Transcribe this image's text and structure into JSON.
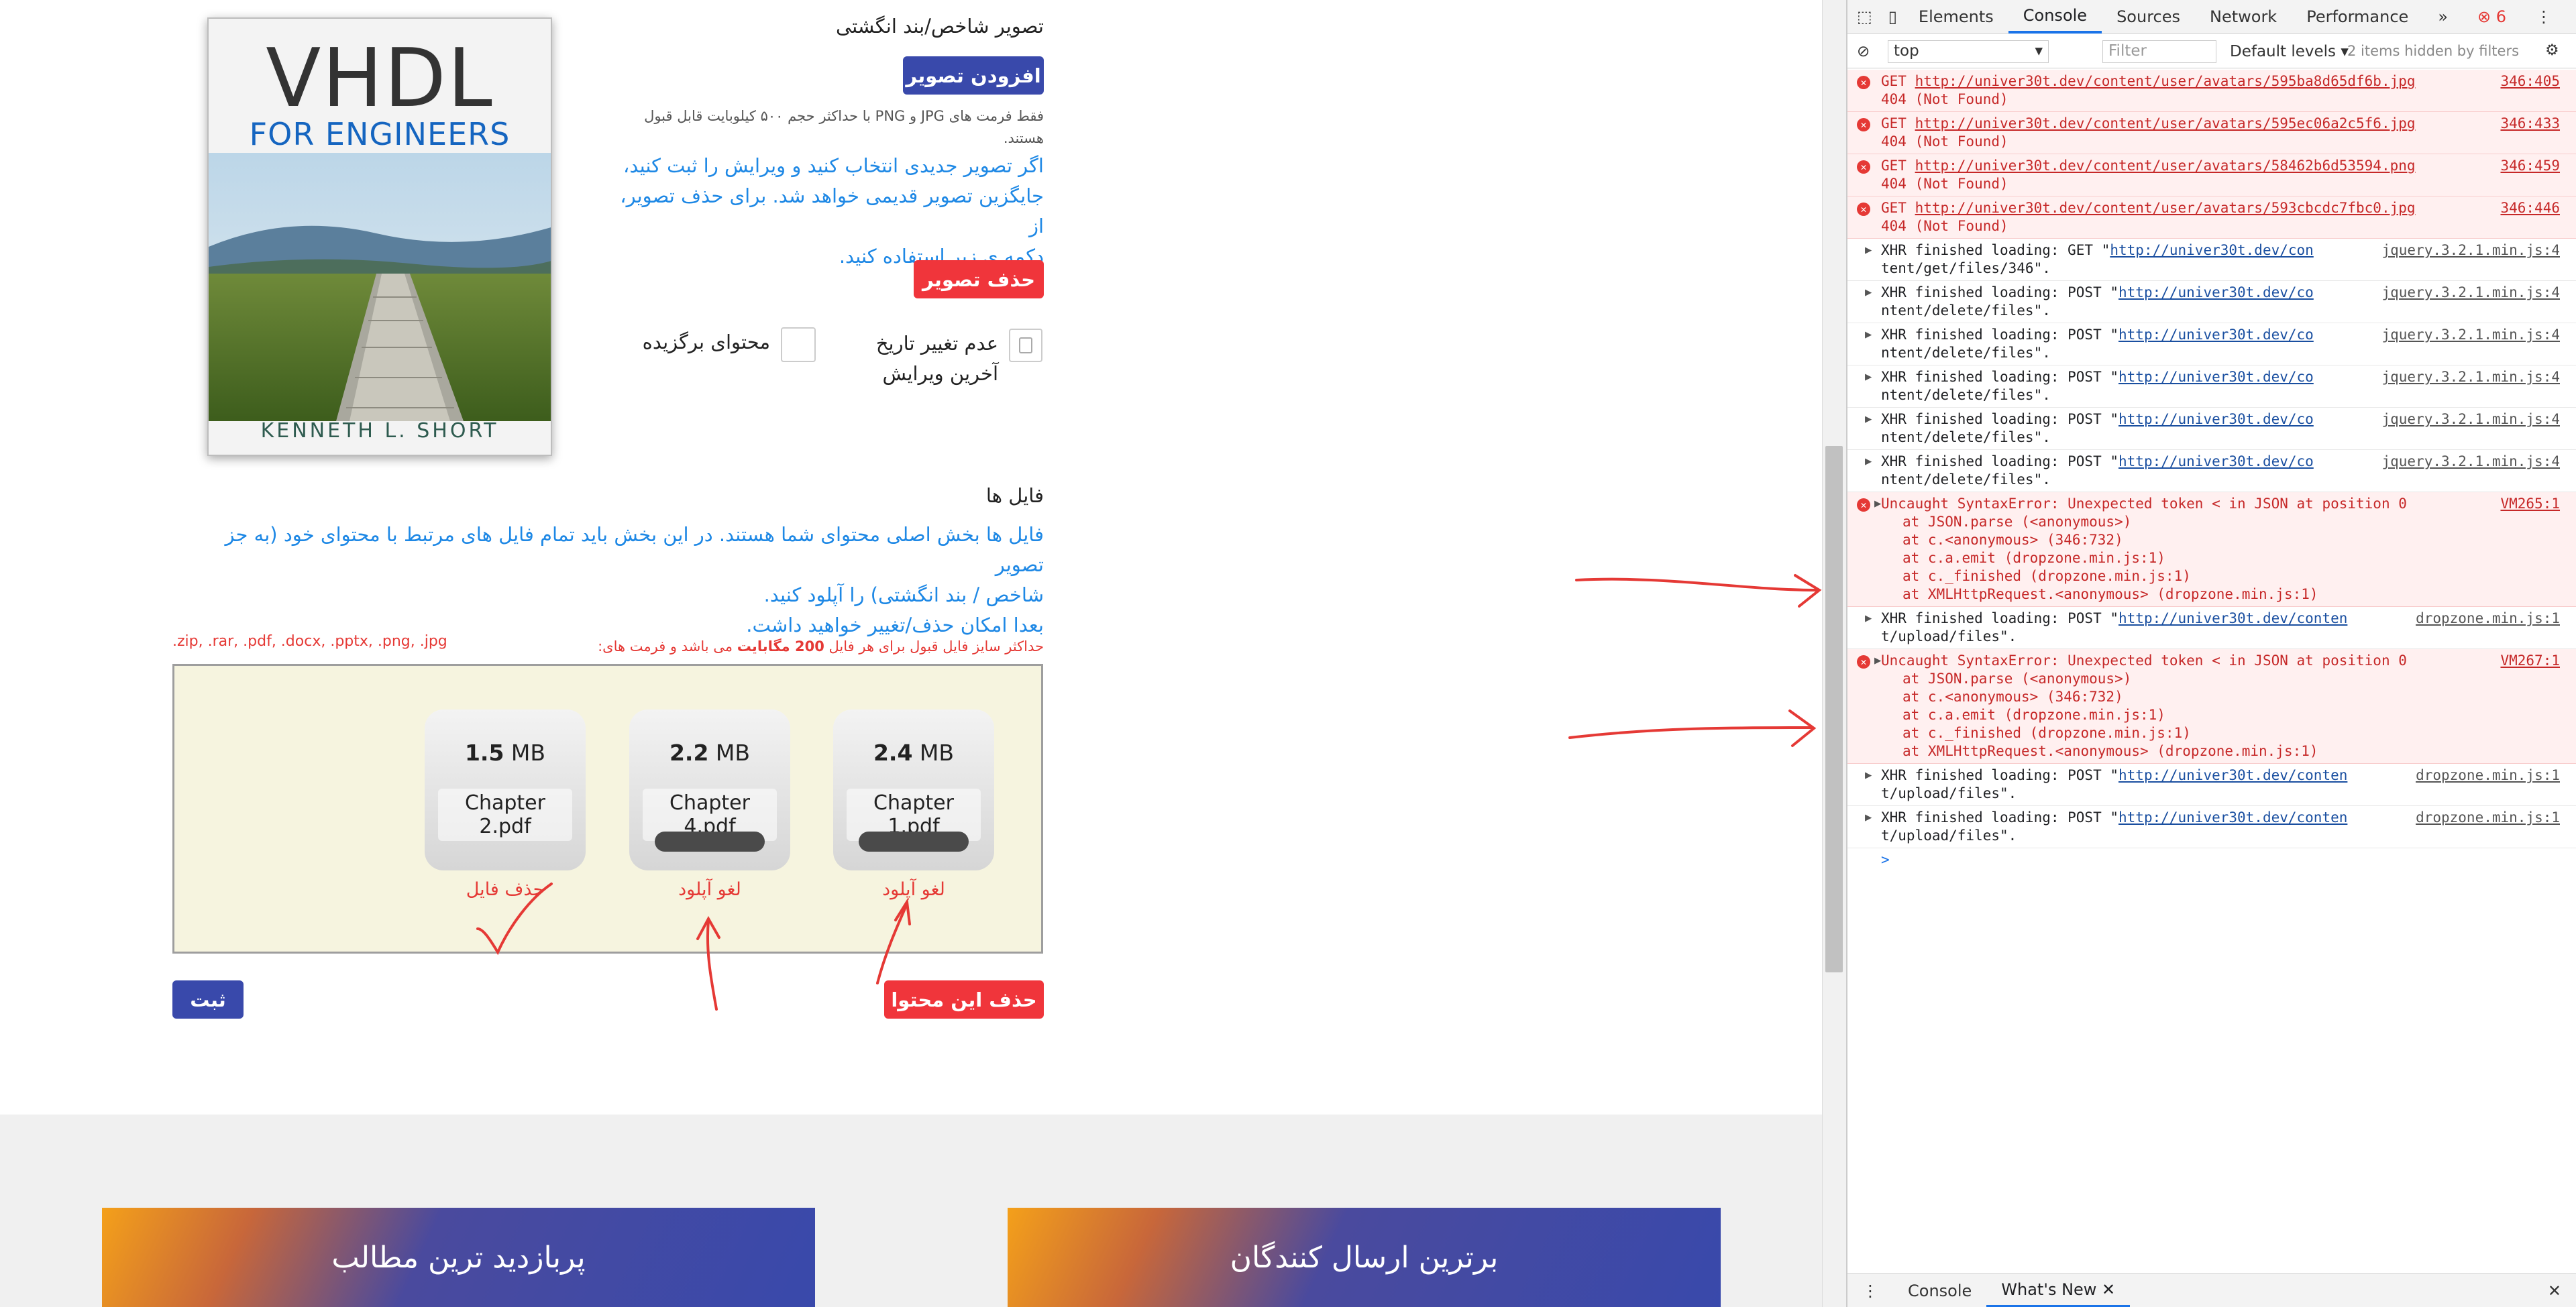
{
  "image_section": {
    "title": "تصویر شاخص/بند انگشتی",
    "add_button": "افزودن تصویر",
    "format_note": "فقط فرمت های JPG و PNG با حداکثر حجم ۵۰۰ کیلوبایت قابل قبول هستند.",
    "help_line1": "اگر تصویر جدیدی انتخاب کنید و ویرایش را ثبت کنید،",
    "help_line2": "جایگزین تصویر قدیمی خواهد شد. برای حذف تصویر، از",
    "help_line3": "دکمه ی زیر استفاده کنید.",
    "delete_button": "حذف تصویر",
    "checkbox1_label_1": "عدم تغییر تاریخ",
    "checkbox1_label_2": "آخرین ویرایش",
    "checkbox2_label": "محتوای برگزیده",
    "book": {
      "title": "VHDL",
      "subtitle": "FOR ENGINEERS",
      "author": "KENNETH L. SHORT"
    }
  },
  "files_section": {
    "title": "فایل ها",
    "desc_line1": "فایل ها بخش اصلی محتوای شما هستند. در این بخش باید تمام فایل های مرتبط با محتوای خود (به جز تصویر",
    "desc_line2": "شاخص / بند انگشتی) را آپلود کنید.",
    "desc_line3": "بعدا امکان حذف/تغییر خواهید داشت.",
    "limit_prefix": "حداکثر سایز فایل قبول برای هر فایل",
    "limit_value": "200 مگابایت",
    "limit_suffix": "می باشد و فرمت های:",
    "formats": ".zip, .rar, .pdf, .docx, .pptx, .png, .jpg",
    "files": [
      {
        "size_num": "2.4",
        "size_unit": "MB",
        "name": "Chapter 1.pdf",
        "action": "لغو آپلود",
        "uploading": true
      },
      {
        "size_num": "2.2",
        "size_unit": "MB",
        "name": "Chapter 4.pdf",
        "action": "لغو آپلود",
        "uploading": true
      },
      {
        "size_num": "1.5",
        "size_unit": "MB",
        "name": "Chapter 2.pdf",
        "action": "حذف فایل",
        "uploading": false
      }
    ],
    "delete_content_button": "حذف این محتوا",
    "submit_button": "ثبت"
  },
  "footer": {
    "box_right": "برترین ارسال کنندگان",
    "box_left": "پربازدید ترین مطالب"
  },
  "devtools": {
    "tabs": [
      "Elements",
      "Console",
      "Sources",
      "Network",
      "Performance"
    ],
    "more": "»",
    "error_count": "6",
    "context": "top",
    "filter_placeholder": "Filter",
    "levels": "Default levels",
    "hidden": "2 items hidden by filters",
    "bottom_tabs": [
      "Console",
      "What's New"
    ],
    "prompt": ">",
    "logs": [
      {
        "type": "error",
        "text1": "GET ",
        "link": "http://univer30t.dev/content/user/avatars/595ba8d65df6b.jpg",
        "text2": "404 (Not Found)",
        "src": "346:405"
      },
      {
        "type": "error",
        "text1": "GET ",
        "link": "http://univer30t.dev/content/user/avatars/595ec06a2c5f6.jpg",
        "text2": "404 (Not Found)",
        "src": "346:433"
      },
      {
        "type": "error",
        "text1": "GET ",
        "link": "http://univer30t.dev/content/user/avatars/58462b6d53594.png",
        "text2": "404 (Not Found)",
        "src": "346:459"
      },
      {
        "type": "error",
        "text1": "GET ",
        "link": "http://univer30t.dev/content/user/avatars/593cbcdc7fbc0.jpg",
        "text2": "404 (Not Found)",
        "src": "346:446"
      },
      {
        "type": "info",
        "text1": "XHR finished loading: GET \"",
        "link": "http://univer30t.dev/con",
        "text2": "tent/get/files/346\".",
        "src": "jquery.3.2.1.min.js:4"
      },
      {
        "type": "info",
        "text1": "XHR finished loading: POST \"",
        "link": "http://univer30t.dev/co",
        "text2": "ntent/delete/files\".",
        "src": "jquery.3.2.1.min.js:4"
      },
      {
        "type": "info",
        "text1": "XHR finished loading: POST \"",
        "link": "http://univer30t.dev/co",
        "text2": "ntent/delete/files\".",
        "src": "jquery.3.2.1.min.js:4"
      },
      {
        "type": "info",
        "text1": "XHR finished loading: POST \"",
        "link": "http://univer30t.dev/co",
        "text2": "ntent/delete/files\".",
        "src": "jquery.3.2.1.min.js:4"
      },
      {
        "type": "info",
        "text1": "XHR finished loading: POST \"",
        "link": "http://univer30t.dev/co",
        "text2": "ntent/delete/files\".",
        "src": "jquery.3.2.1.min.js:4"
      },
      {
        "type": "info",
        "text1": "XHR finished loading: POST \"",
        "link": "http://univer30t.dev/co",
        "text2": "ntent/delete/files\".",
        "src": "jquery.3.2.1.min.js:4"
      },
      {
        "type": "stack",
        "text1": "Uncaught SyntaxError: Unexpected token < in JSON at position 0",
        "lines": [
          "at JSON.parse (<anonymous>)",
          "at c.<anonymous> (346:732)",
          "at c.a.emit (dropzone.min.js:1)",
          "at c._finished (dropzone.min.js:1)",
          "at XMLHttpRequest.<anonymous> (dropzone.min.js:1)"
        ],
        "src": "VM265:1"
      },
      {
        "type": "info",
        "text1": "XHR finished loading: POST \"",
        "link": "http://univer30t.dev/conten",
        "text2": "t/upload/files\".",
        "src": "dropzone.min.js:1"
      },
      {
        "type": "stack",
        "text1": "Uncaught SyntaxError: Unexpected token < in JSON at position 0",
        "lines": [
          "at JSON.parse (<anonymous>)",
          "at c.<anonymous> (346:732)",
          "at c.a.emit (dropzone.min.js:1)",
          "at c._finished (dropzone.min.js:1)",
          "at XMLHttpRequest.<anonymous> (dropzone.min.js:1)"
        ],
        "src": "VM267:1"
      },
      {
        "type": "info",
        "text1": "XHR finished loading: POST \"",
        "link": "http://univer30t.dev/conten",
        "text2": "t/upload/files\".",
        "src": "dropzone.min.js:1"
      },
      {
        "type": "info",
        "text1": "XHR finished loading: POST \"",
        "link": "http://univer30t.dev/conten",
        "text2": "t/upload/files\".",
        "src": "dropzone.min.js:1"
      }
    ]
  },
  "colors": {
    "primary": "#3949ab",
    "danger": "#f0353b",
    "link": "#1e88e5",
    "annotation": "#e53935"
  }
}
